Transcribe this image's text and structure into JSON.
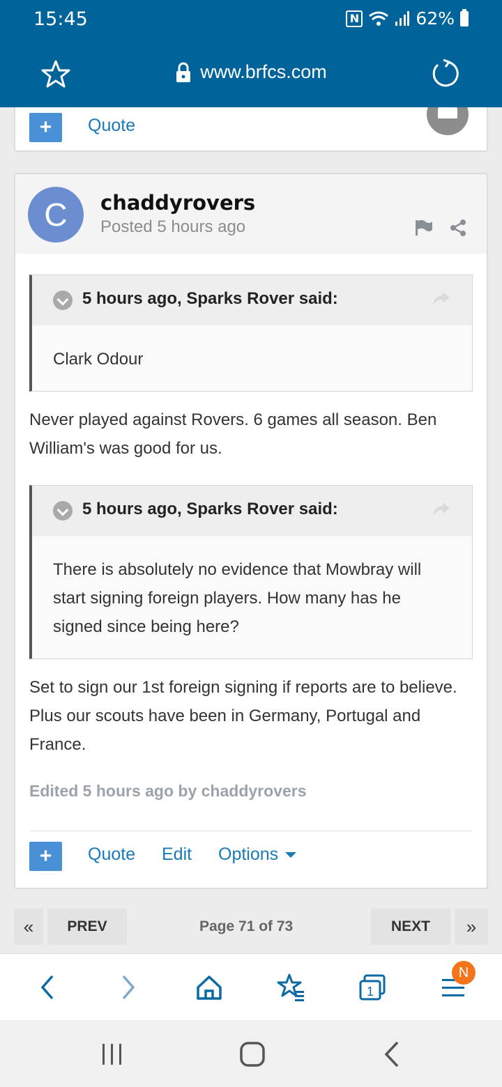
{
  "status_bar": {
    "time": "15:45",
    "nfc": "N",
    "battery": "62%"
  },
  "url_bar": {
    "url": "www.brfcs.com"
  },
  "prev_card": {
    "quote_label": "Quote"
  },
  "post": {
    "avatar_letter": "C",
    "author": "chaddyrovers",
    "posted": "Posted 5 hours ago",
    "quotes": [
      {
        "cite": "5 hours ago, Sparks Rover said:",
        "body": "Clark Odour"
      },
      {
        "cite": "5 hours ago, Sparks Rover said:",
        "body": "There is absolutely no evidence that Mowbray will start signing foreign players.  How many has he signed since being here?"
      }
    ],
    "paragraphs": [
      "Never played against Rovers. 6 games all season. Ben William's was good for us.",
      "Set to sign our 1st foreign signing if reports are to believe. Plus our scouts have been in Germany, Portugal and France."
    ],
    "edited": "Edited 5 hours ago by chaddyrovers",
    "actions": {
      "plus": "+",
      "quote": "Quote",
      "edit": "Edit",
      "options": "Options"
    }
  },
  "pagination": {
    "first": "«",
    "prev": "PREV",
    "page": "Page 71 of 73",
    "next": "NEXT",
    "last": "»"
  },
  "toolbar": {
    "tabs_count": "1",
    "notification_badge": "N"
  },
  "icons": [
    "star-icon",
    "lock-icon",
    "refresh-icon",
    "heart-icon",
    "flag-icon",
    "share-icon",
    "chevron-down-icon",
    "reply-arrow-icon",
    "back-arrow-icon",
    "forward-arrow-icon",
    "home-icon",
    "bookmarks-icon",
    "tabs-icon",
    "menu-icon",
    "recents-icon",
    "home-circle-icon",
    "back-icon"
  ],
  "colors": {
    "brand": "#00649b",
    "link": "#1a79b8",
    "plus_button": "#4a90d6",
    "badge": "#f4741b"
  }
}
